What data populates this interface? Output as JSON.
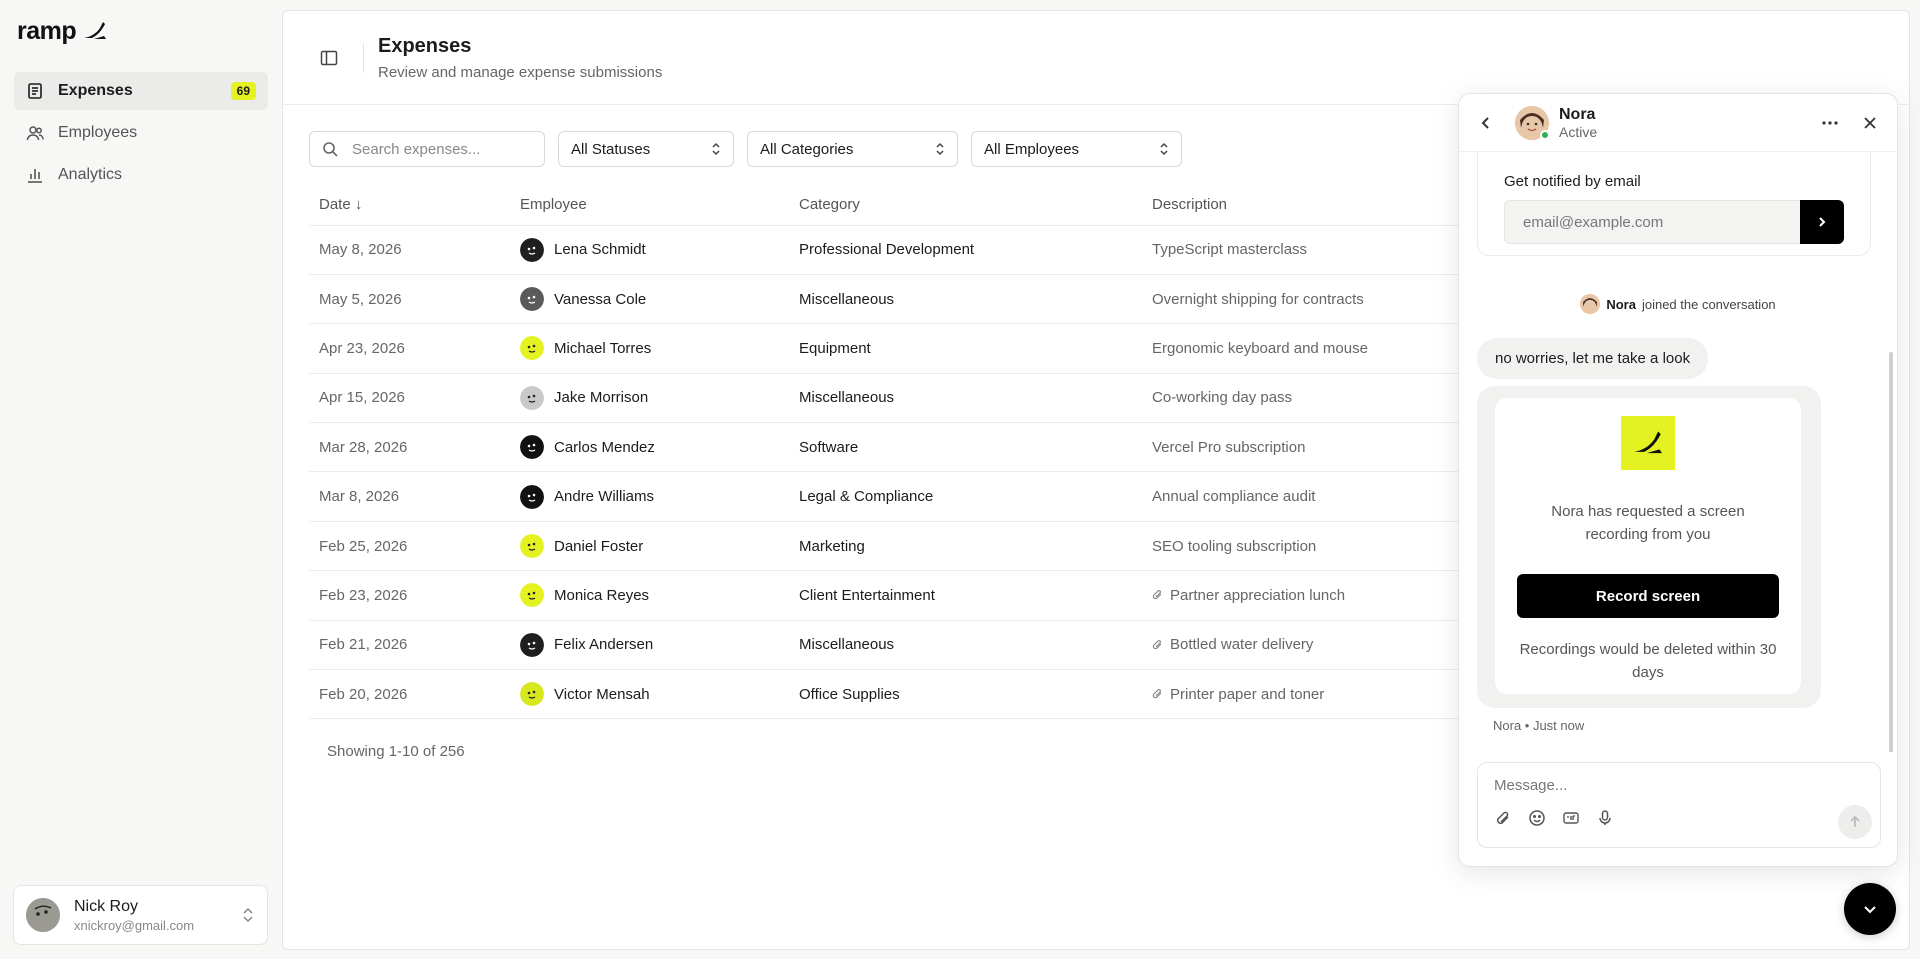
{
  "brand": {
    "name": "ramp"
  },
  "sidebar": {
    "items": [
      {
        "label": "Expenses",
        "badge": "69"
      },
      {
        "label": "Employees"
      },
      {
        "label": "Analytics"
      }
    ],
    "user": {
      "name": "Nick Roy",
      "email": "xnickroy@gmail.com"
    }
  },
  "header": {
    "title": "Expenses",
    "subtitle": "Review and manage expense submissions"
  },
  "filters": {
    "search_placeholder": "Search expenses...",
    "status": "All Statuses",
    "category": "All Categories",
    "employee": "All Employees"
  },
  "table": {
    "columns": [
      "Date ↓",
      "Employee",
      "Category",
      "Description"
    ],
    "rows": [
      {
        "date": "May 8, 2026",
        "employee": "Lena Schmidt",
        "category": "Professional Development",
        "description": "TypeScript masterclass",
        "attachment": false,
        "avatar_color": "#1f1f1f"
      },
      {
        "date": "May 5, 2026",
        "employee": "Vanessa Cole",
        "category": "Miscellaneous",
        "description": "Overnight shipping for contracts",
        "attachment": false,
        "avatar_color": "#5a5a5a"
      },
      {
        "date": "Apr 23, 2026",
        "employee": "Michael Torres",
        "category": "Equipment",
        "description": "Ergonomic keyboard and mouse",
        "attachment": false,
        "avatar_color": "#e4f222"
      },
      {
        "date": "Apr 15, 2026",
        "employee": "Jake Morrison",
        "category": "Miscellaneous",
        "description": "Co-working day pass",
        "attachment": false,
        "avatar_color": "#c9c9c9"
      },
      {
        "date": "Mar 28, 2026",
        "employee": "Carlos Mendez",
        "category": "Software",
        "description": "Vercel Pro subscription",
        "attachment": false,
        "avatar_color": "#111111"
      },
      {
        "date": "Mar 8, 2026",
        "employee": "Andre Williams",
        "category": "Legal & Compliance",
        "description": "Annual compliance audit",
        "attachment": false,
        "avatar_color": "#111111"
      },
      {
        "date": "Feb 25, 2026",
        "employee": "Daniel Foster",
        "category": "Marketing",
        "description": "SEO tooling subscription",
        "attachment": false,
        "avatar_color": "#e4f222"
      },
      {
        "date": "Feb 23, 2026",
        "employee": "Monica Reyes",
        "category": "Client Entertainment",
        "description": "Partner appreciation lunch",
        "attachment": true,
        "avatar_color": "#e4f222"
      },
      {
        "date": "Feb 21, 2026",
        "employee": "Felix Andersen",
        "category": "Miscellaneous",
        "description": "Bottled water delivery",
        "attachment": true,
        "avatar_color": "#1f1f1f"
      },
      {
        "date": "Feb 20, 2026",
        "employee": "Victor Mensah",
        "category": "Office Supplies",
        "description": "Printer paper and toner",
        "attachment": true,
        "avatar_color": "#d7e81f"
      }
    ],
    "showing": "Showing 1-10 of 256"
  },
  "chat": {
    "agent_name": "Nora",
    "agent_status": "Active",
    "email_prompt": "Get notified by email",
    "email_placeholder": "email@example.com",
    "joined_name": "Nora",
    "joined_text": "joined the conversation",
    "message": "no worries, let me take a look",
    "request_text": "Nora has requested a screen recording from you",
    "record_label": "Record screen",
    "request_note": "Recordings would be deleted within 30 days",
    "meta": "Nora • Just now",
    "composer_placeholder": "Message..."
  },
  "colors": {
    "accent": "#e4f222",
    "online": "#2bb35a"
  }
}
